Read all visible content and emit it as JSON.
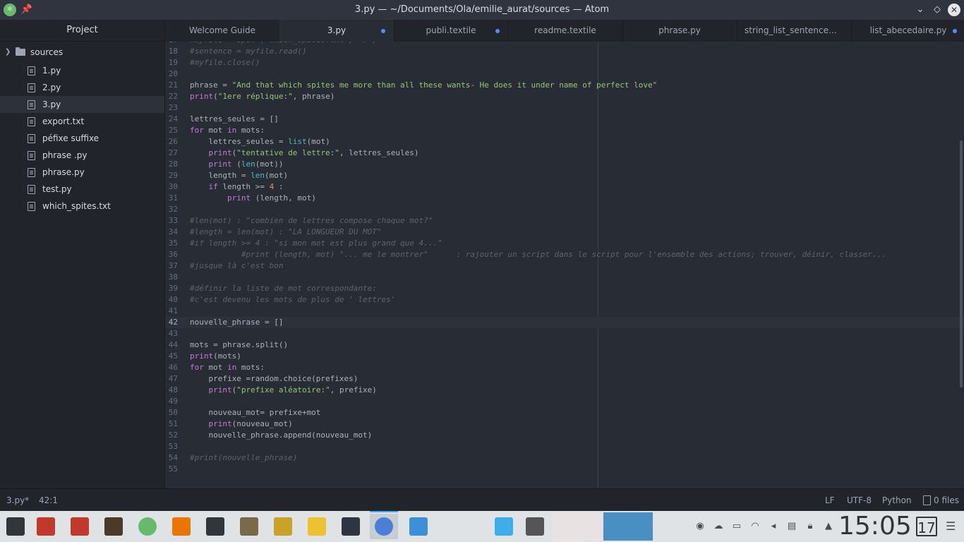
{
  "window": {
    "title": "3.py — ~/Documents/Ola/emilie_aurat/sources — Atom"
  },
  "sidebar": {
    "header": "Project",
    "folder": "sources",
    "files": [
      {
        "label": "1.py"
      },
      {
        "label": "2.py"
      },
      {
        "label": "3.py",
        "selected": true
      },
      {
        "label": "export.txt"
      },
      {
        "label": "péfixe suffixe"
      },
      {
        "label": "phrase .py"
      },
      {
        "label": "phrase.py"
      },
      {
        "label": "test.py"
      },
      {
        "label": "which_spites.txt"
      }
    ]
  },
  "tabs": [
    {
      "label": "Welcome Guide",
      "modified": false,
      "active": false
    },
    {
      "label": "3.py",
      "modified": true,
      "active": true
    },
    {
      "label": "publi.textile",
      "modified": true,
      "active": false
    },
    {
      "label": "readme.textile",
      "modified": false,
      "active": false
    },
    {
      "label": "phrase.py",
      "modified": false,
      "active": false
    },
    {
      "label": "string_list_sentenceword",
      "modified": false,
      "active": false
    },
    {
      "label": "list_abecedaire.py",
      "modified": true,
      "active": false
    }
  ],
  "editor": {
    "cursor_line": 42,
    "lines": [
      {
        "n": "17",
        "tokens": [
          [
            "c",
            "#myfile = open (\"which_spites.txt\", 'r')"
          ]
        ]
      },
      {
        "n": "18",
        "tokens": [
          [
            "c",
            "#sentence = myfile.read()"
          ]
        ]
      },
      {
        "n": "19",
        "tokens": [
          [
            "c",
            "#myfile.close()"
          ]
        ]
      },
      {
        "n": "20",
        "tokens": []
      },
      {
        "n": "21",
        "tokens": [
          [
            "p",
            "phrase = "
          ],
          [
            "s",
            "\"And that which spites me more than all these wants- He does it under name of perfect love\""
          ]
        ]
      },
      {
        "n": "22",
        "tokens": [
          [
            "k",
            "print"
          ],
          [
            "p",
            "("
          ],
          [
            "s",
            "\"1ere réplique:\""
          ],
          [
            "p",
            ", phrase)"
          ]
        ]
      },
      {
        "n": "23",
        "tokens": []
      },
      {
        "n": "24",
        "tokens": [
          [
            "p",
            "lettres_seules = []"
          ]
        ]
      },
      {
        "n": "25",
        "tokens": [
          [
            "k",
            "for"
          ],
          [
            "p",
            " mot "
          ],
          [
            "k",
            "in"
          ],
          [
            "p",
            " mots:"
          ]
        ]
      },
      {
        "n": "26",
        "tokens": [
          [
            "p",
            "    lettres_seules = "
          ],
          [
            "b",
            "list"
          ],
          [
            "p",
            "(mot)"
          ]
        ]
      },
      {
        "n": "27",
        "tokens": [
          [
            "p",
            "    "
          ],
          [
            "k",
            "print"
          ],
          [
            "p",
            "("
          ],
          [
            "s",
            "\"tentative de lettre:\""
          ],
          [
            "p",
            ", lettres_seules)"
          ]
        ]
      },
      {
        "n": "28",
        "tokens": [
          [
            "p",
            "    "
          ],
          [
            "k",
            "print"
          ],
          [
            "p",
            " ("
          ],
          [
            "b",
            "len"
          ],
          [
            "p",
            "(mot))"
          ]
        ]
      },
      {
        "n": "29",
        "tokens": [
          [
            "p",
            "    length = "
          ],
          [
            "b",
            "len"
          ],
          [
            "p",
            "(mot)"
          ]
        ]
      },
      {
        "n": "30",
        "tokens": [
          [
            "p",
            "    "
          ],
          [
            "k",
            "if"
          ],
          [
            "p",
            " length >= "
          ],
          [
            "n",
            "4"
          ],
          [
            "p",
            " :"
          ]
        ]
      },
      {
        "n": "31",
        "tokens": [
          [
            "p",
            "        "
          ],
          [
            "k",
            "print"
          ],
          [
            "p",
            " (length, mot)"
          ]
        ]
      },
      {
        "n": "32",
        "tokens": []
      },
      {
        "n": "33",
        "tokens": [
          [
            "c",
            "#len(mot) : \"combien de lettres compose chaque mot?\""
          ]
        ]
      },
      {
        "n": "34",
        "tokens": [
          [
            "c",
            "#length = len(mot) : \"LA LONGUEUR DU MOT\""
          ]
        ]
      },
      {
        "n": "35",
        "tokens": [
          [
            "c",
            "#if length >= 4 : \"si mon mot est plus grand que 4...\""
          ]
        ]
      },
      {
        "n": "36",
        "tokens": [
          [
            "c",
            "           #print (length, mot) \"... me le montrer\"      : rajouter un script dans le script pour l'ensemble des actions; trouver, déinir, classer..."
          ]
        ]
      },
      {
        "n": "37",
        "tokens": [
          [
            "c",
            "#jusque là c'est bon"
          ]
        ]
      },
      {
        "n": "38",
        "tokens": []
      },
      {
        "n": "39",
        "tokens": [
          [
            "c",
            "#définir la liste de mot correspondante:"
          ]
        ]
      },
      {
        "n": "40",
        "tokens": [
          [
            "c",
            "#c'est devenu les mots de plus de ' lettres'"
          ]
        ]
      },
      {
        "n": "41",
        "tokens": []
      },
      {
        "n": "42",
        "tokens": [
          [
            "p",
            "nouvelle_phrase = []"
          ]
        ]
      },
      {
        "n": "43",
        "tokens": []
      },
      {
        "n": "44",
        "tokens": [
          [
            "p",
            "mots = phrase.split()"
          ]
        ]
      },
      {
        "n": "45",
        "tokens": [
          [
            "k",
            "print"
          ],
          [
            "p",
            "(mots)"
          ]
        ]
      },
      {
        "n": "46",
        "tokens": [
          [
            "k",
            "for"
          ],
          [
            "p",
            " mot "
          ],
          [
            "k",
            "in"
          ],
          [
            "p",
            " mots:"
          ]
        ]
      },
      {
        "n": "47",
        "tokens": [
          [
            "p",
            "    prefixe =random.choice(prefixes)"
          ]
        ]
      },
      {
        "n": "48",
        "tokens": [
          [
            "p",
            "    "
          ],
          [
            "k",
            "print"
          ],
          [
            "p",
            "("
          ],
          [
            "s",
            "\"prefixe aléatoire:\""
          ],
          [
            "p",
            ", prefixe)"
          ]
        ]
      },
      {
        "n": "49",
        "tokens": []
      },
      {
        "n": "50",
        "tokens": [
          [
            "p",
            "    nouveau_mot= prefixe+mot"
          ]
        ]
      },
      {
        "n": "51",
        "tokens": [
          [
            "p",
            "    "
          ],
          [
            "k",
            "print"
          ],
          [
            "p",
            "(nouveau_mot)"
          ]
        ]
      },
      {
        "n": "52",
        "tokens": [
          [
            "p",
            "    nouvelle_phrase.append(nouveau_mot)"
          ]
        ]
      },
      {
        "n": "53",
        "tokens": []
      },
      {
        "n": "54",
        "tokens": [
          [
            "c",
            "#print(nouvelle_phrase)"
          ]
        ]
      },
      {
        "n": "55",
        "tokens": []
      }
    ]
  },
  "statusbar": {
    "file": "3.py*",
    "position": "42:1",
    "line_ending": "LF",
    "encoding": "UTF-8",
    "grammar": "Python",
    "git": "0 files"
  },
  "taskbar": {
    "clock": "15:05",
    "date_day": "17",
    "apps": [
      {
        "name": "app-launcher-icon",
        "color": "#31363b"
      },
      {
        "name": "terminal-icon",
        "color": "#c0392b"
      },
      {
        "name": "terminal-2-icon",
        "color": "#c0392b"
      },
      {
        "name": "inkscape-icon",
        "color": "#4a3a2a"
      },
      {
        "name": "atom-icon",
        "color": "#66bb6a"
      },
      {
        "name": "blender-icon",
        "color": "#ea7600"
      },
      {
        "name": "krita-icon",
        "color": "#31363b"
      },
      {
        "name": "gimp-icon",
        "color": "#7a6a4a"
      },
      {
        "name": "game-icon",
        "color": "#c9a227"
      },
      {
        "name": "2048-icon",
        "color": "#edc22e"
      },
      {
        "name": "kdenlive-icon",
        "color": "#2e3440"
      },
      {
        "name": "chromium-icon",
        "color": "#4a7fd8"
      },
      {
        "name": "file-manager-icon",
        "color": "#3d8fd6"
      },
      {
        "name": "app-icon",
        "color": "#3daee9"
      },
      {
        "name": "notes-icon",
        "color": "#555555"
      }
    ]
  },
  "colors": {
    "accent": "#528bff",
    "string": "#98c379",
    "keyword": "#c678dd",
    "builtin": "#56b6c2",
    "comment": "#5c6370"
  }
}
